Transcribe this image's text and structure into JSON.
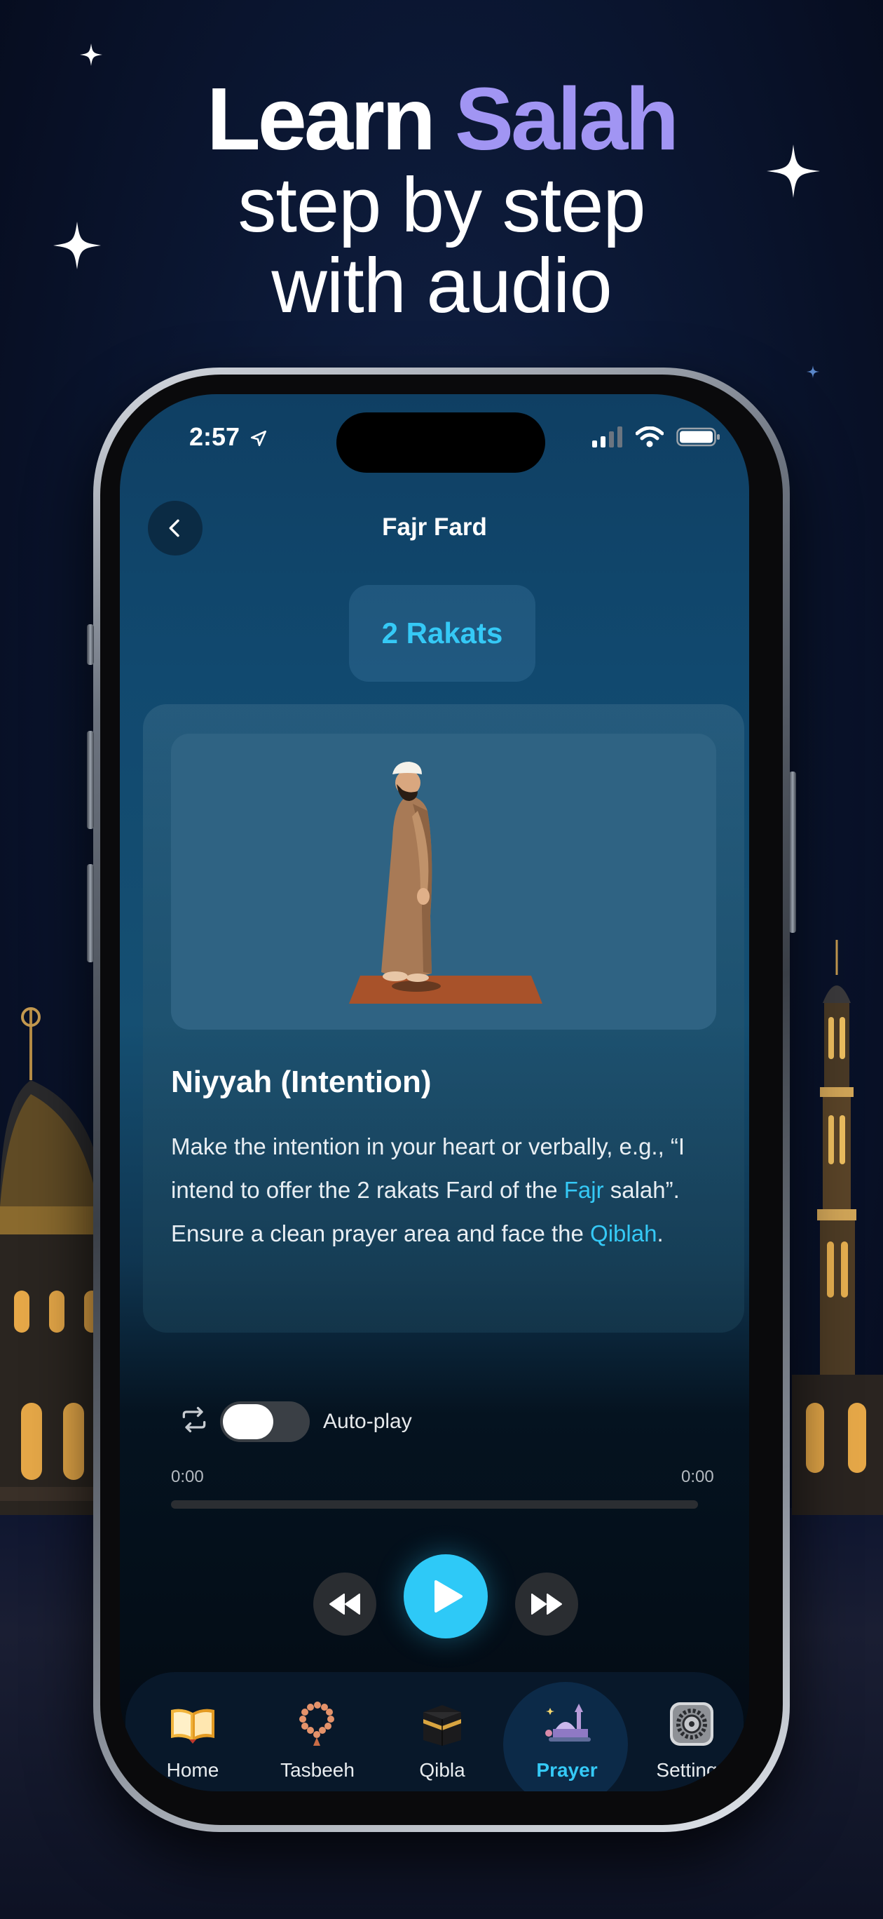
{
  "promo": {
    "headline_word1": "Learn",
    "headline_word2": "Salah",
    "headline_line2": "step by step",
    "headline_line3": "with audio"
  },
  "status_bar": {
    "time": "2:57",
    "location_icon": "location-arrow-icon",
    "signal_icon": "cellular-signal-icon",
    "wifi_icon": "wifi-icon",
    "battery_icon": "battery-icon"
  },
  "header": {
    "back_icon": "chevron-left-icon",
    "title": "Fajr Fard"
  },
  "rakats_label": "2 Rakats",
  "step": {
    "illustration": "man-standing-on-prayer-mat",
    "title": "Niyyah (Intention)",
    "body_part1": "Make the intention in your heart or verbally, e.g., “I intend to offer the 2 rakats Fard of the ",
    "body_highlight1": "Fajr",
    "body_part2": " salah”. Ensure a clean prayer area and face the ",
    "body_highlight2": "Qiblah",
    "body_part3": "."
  },
  "player": {
    "repeat_icon": "repeat-icon",
    "autoplay_label": "Auto-play",
    "autoplay_on": false,
    "time_current": "0:00",
    "time_total": "0:00",
    "progress": 0,
    "rewind_icon": "rewind-icon",
    "play_icon": "play-icon",
    "forward_icon": "fast-forward-icon"
  },
  "tabs": [
    {
      "label": "Home",
      "icon": "open-book-icon",
      "active": false
    },
    {
      "label": "Tasbeeh",
      "icon": "prayer-beads-icon",
      "active": false
    },
    {
      "label": "Qibla",
      "icon": "kaaba-icon",
      "active": false
    },
    {
      "label": "Prayer",
      "icon": "mosque-icon",
      "active": true
    },
    {
      "label": "Settings",
      "icon": "settings-gear-icon",
      "active": false
    }
  ],
  "colors": {
    "accent": "#35c9f6",
    "headline_accent": "#a195f3",
    "play_button": "#2ec9f7"
  }
}
